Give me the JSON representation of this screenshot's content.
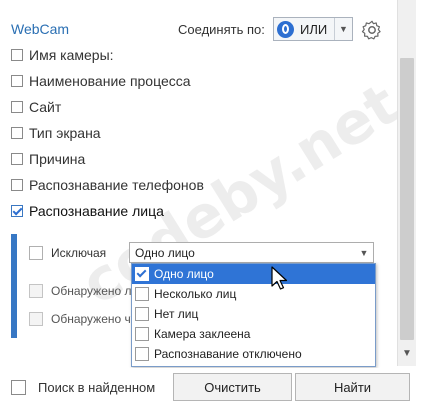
{
  "header": {
    "title": "WebCam",
    "connect_label": "Соединять по:",
    "connect_value": "ИЛИ"
  },
  "filters": [
    {
      "label": "Имя камеры:",
      "checked": false
    },
    {
      "label": "Наименование процесса",
      "checked": false
    },
    {
      "label": "Сайт",
      "checked": false
    },
    {
      "label": "Тип экрана",
      "checked": false
    },
    {
      "label": "Причина",
      "checked": false
    },
    {
      "label": "Распознавание телефонов",
      "checked": false
    },
    {
      "label": "Распознавание лица",
      "checked": true
    }
  ],
  "face_section": {
    "exclude_label": "Исключая",
    "detected_label_1": "Обнаружено ли",
    "detected_label_2": "Обнаружено чу",
    "select_value": "Одно лицо",
    "options": [
      {
        "label": "Одно лицо",
        "checked": true
      },
      {
        "label": "Несколько лиц",
        "checked": false
      },
      {
        "label": "Нет лиц",
        "checked": false
      },
      {
        "label": "Камера заклеена",
        "checked": false
      },
      {
        "label": "Распознавание отключено",
        "checked": false
      }
    ]
  },
  "footer": {
    "search_in_found_label": "Поиск в найденном",
    "clear_button": "Очистить",
    "find_button": "Найти"
  },
  "watermark": "codeby.net",
  "colors": {
    "accent": "#2d6fd1",
    "title": "#2a6fb3",
    "selected_row": "#2f74d6"
  }
}
